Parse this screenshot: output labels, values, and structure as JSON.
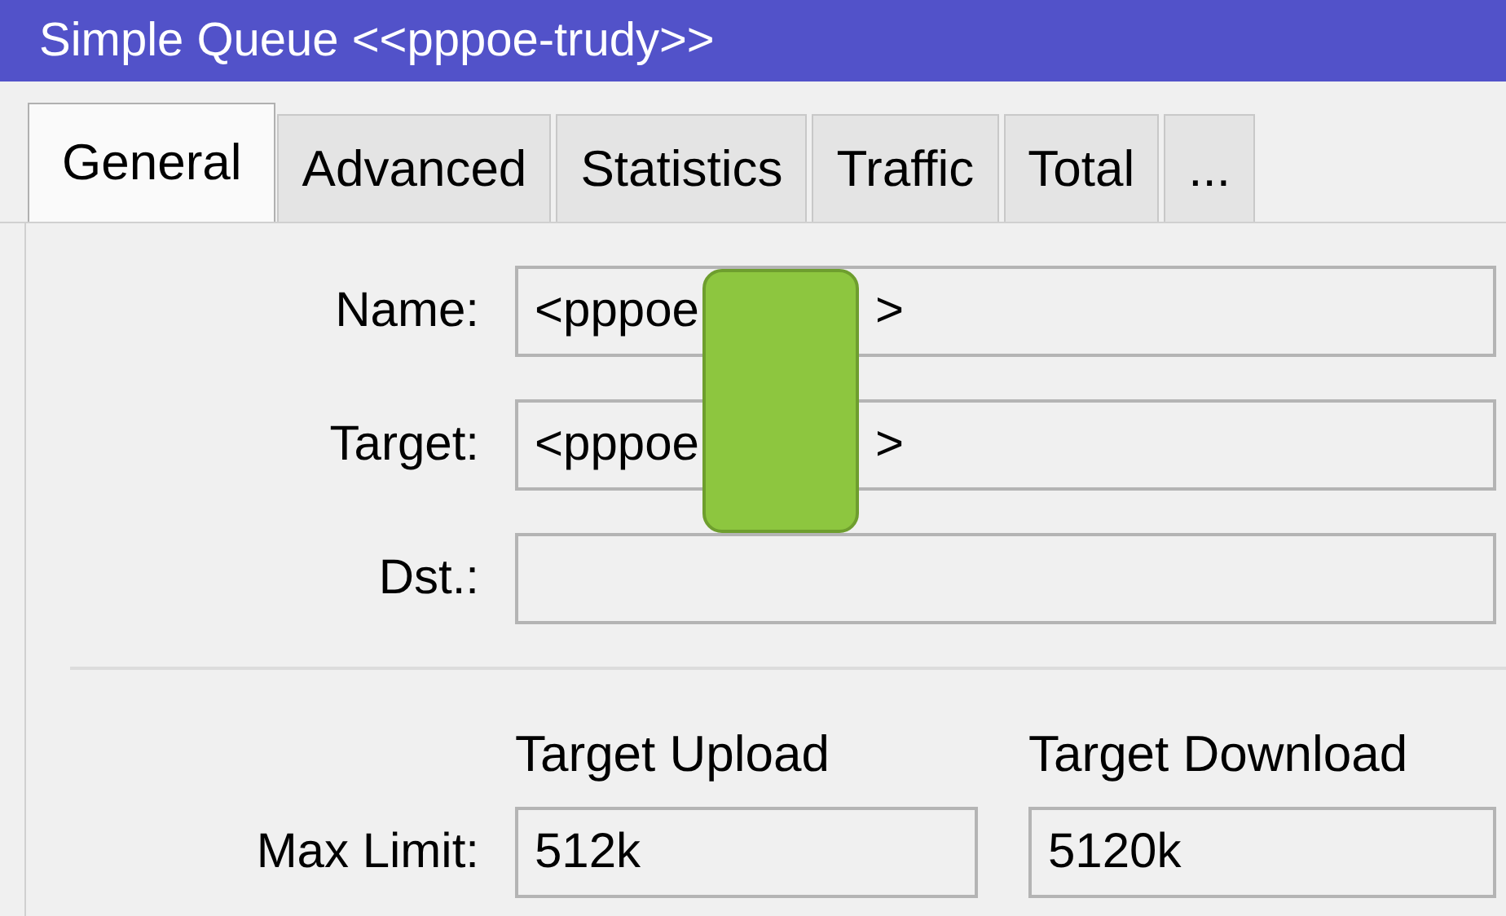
{
  "window": {
    "title": "Simple Queue <<pppoe-trudy>>"
  },
  "tabs": [
    {
      "label": "General",
      "selected": true
    },
    {
      "label": "Advanced",
      "selected": false
    },
    {
      "label": "Statistics",
      "selected": false
    },
    {
      "label": "Traffic",
      "selected": false
    },
    {
      "label": "Total",
      "selected": false
    },
    {
      "label": "...",
      "selected": false
    }
  ],
  "fields": [
    {
      "label": "Name:",
      "value_parts": [
        "<pppoe",
        ">"
      ]
    },
    {
      "label": "Target:",
      "value_parts": [
        "<pppoe",
        ">"
      ]
    },
    {
      "label": "Dst.:"
    }
  ],
  "limits": {
    "columns": [
      "Target Upload",
      "Target Download"
    ],
    "rows": [
      {
        "label": "Max Limit:",
        "values": [
          "512k",
          "5120k"
        ]
      }
    ]
  }
}
